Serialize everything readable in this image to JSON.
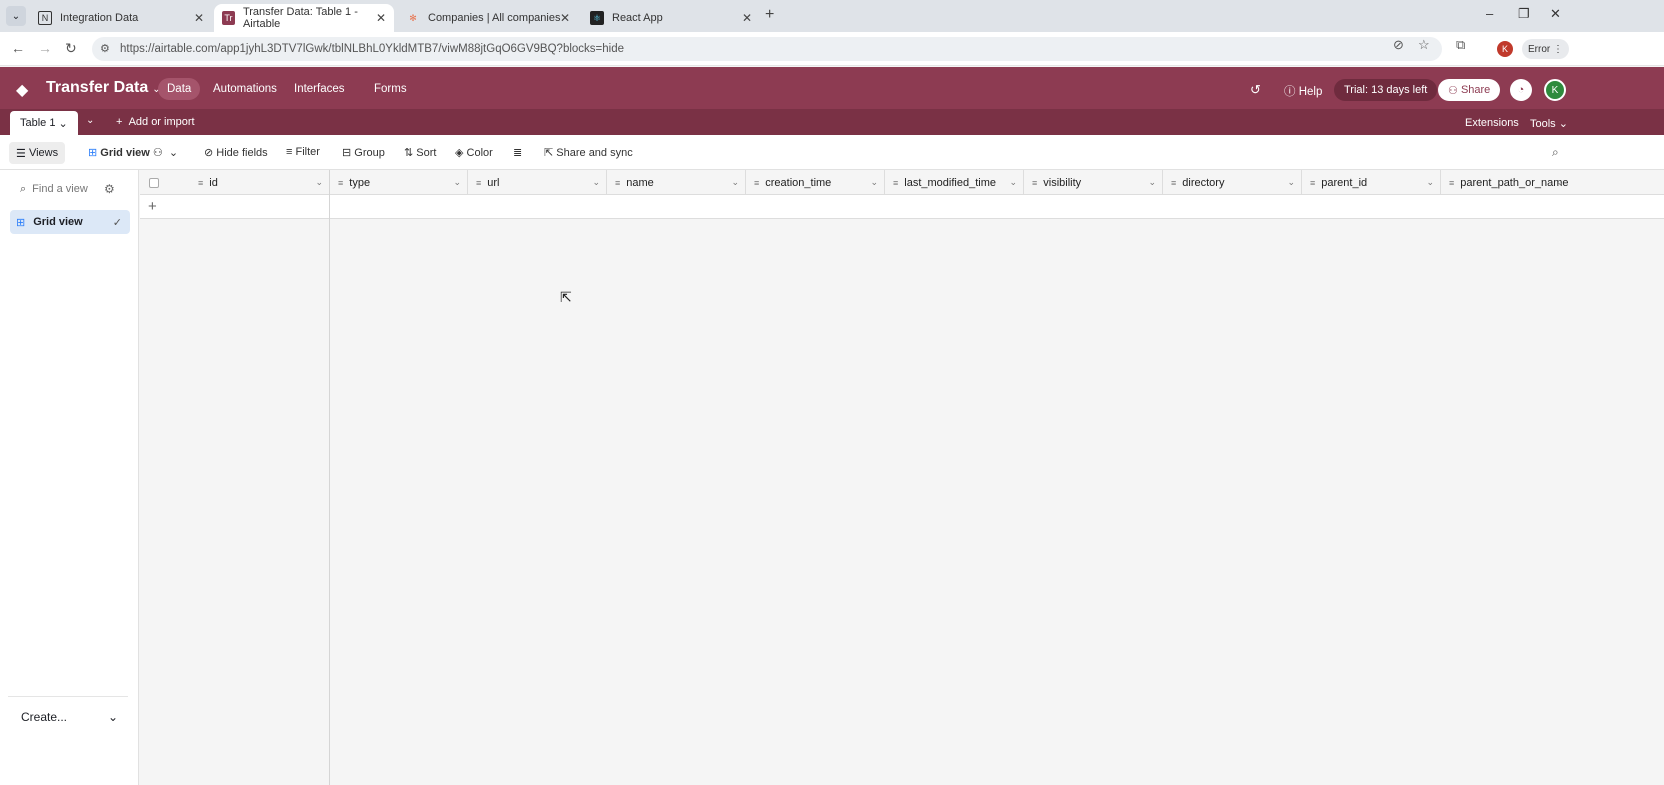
{
  "browser": {
    "tabs": [
      {
        "title": "Integration Data",
        "favicon": "N"
      },
      {
        "title": "Transfer Data: Table 1 - Airtable",
        "favicon": "Tr"
      },
      {
        "title": "Companies | All companies",
        "favicon": "✻"
      },
      {
        "title": "React App",
        "favicon": "⚛"
      }
    ],
    "url": "https://airtable.com/app1jyhL3DTV7lGwk/tblNLBhL0YkldMTB7/viwM88jtGqO6GV9BQ?blocks=hide",
    "profile_initial": "K",
    "error_label": "Error"
  },
  "app": {
    "base_name": "Transfer Data",
    "nav": [
      "Data",
      "Automations",
      "Interfaces",
      "Forms"
    ],
    "help": "Help",
    "trial": "Trial: 13 days left",
    "share": "Share",
    "avatar_initial": "K",
    "brand_color": "#8d3b52"
  },
  "tablebar": {
    "table_name": "Table 1",
    "add_import": "Add or import",
    "extensions": "Extensions",
    "tools": "Tools"
  },
  "toolbar": {
    "views": "Views",
    "grid_view": "Grid view",
    "hide_fields": "Hide fields",
    "filter": "Filter",
    "group": "Group",
    "sort": "Sort",
    "color": "Color",
    "share_sync": "Share and sync"
  },
  "sidebar": {
    "find_placeholder": "Find a view",
    "view_item": "Grid view",
    "create": "Create..."
  },
  "grid": {
    "columns": [
      "id",
      "type",
      "url",
      "name",
      "creation_time",
      "last_modified_time",
      "visibility",
      "directory",
      "parent_id",
      "parent_path_or_name"
    ]
  }
}
